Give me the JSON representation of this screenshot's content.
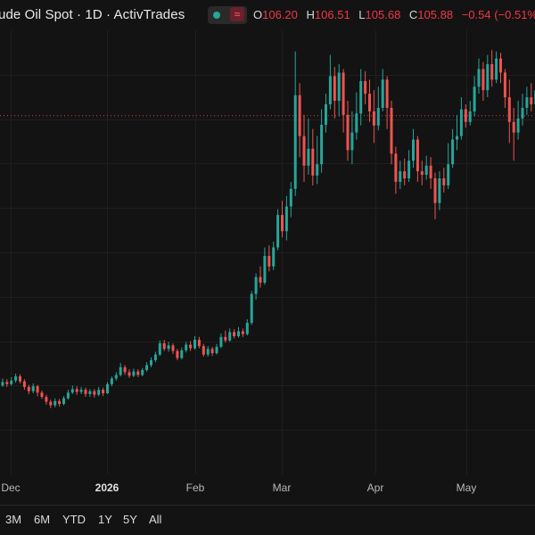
{
  "header": {
    "title": "ude Oil Spot · 1D · ActivTrades",
    "ohlc": [
      {
        "key": "O",
        "value": "106.20"
      },
      {
        "key": "H",
        "value": "106.51"
      },
      {
        "key": "L",
        "value": "105.68"
      },
      {
        "key": "C",
        "value": "105.88"
      }
    ],
    "change": "−0.54 (−0.51%",
    "status_icon": "waves-icon"
  },
  "range_buttons": [
    "3M",
    "6M",
    "YTD",
    "1Y",
    "5Y",
    "All"
  ],
  "colors": {
    "up": "#26a69a",
    "down": "#ef5350",
    "background": "#131313",
    "grid": "#1f1f1f",
    "last_price_line": "#f23645"
  },
  "chart_data": {
    "type": "candlestick",
    "x_tick_labels": [
      "Dec",
      "2026",
      "Feb",
      "Mar",
      "Apr",
      "May"
    ],
    "last_price": 105.88,
    "ylim": [
      55,
      118
    ],
    "candles": [
      [
        68,
        67.6,
        68.4,
        67.2
      ],
      [
        67.6,
        68.1,
        68.6,
        67.4
      ],
      [
        68.1,
        67.8,
        68.5,
        67.4
      ],
      [
        67.8,
        68.3,
        68.8,
        67.6
      ],
      [
        68.3,
        68.9,
        69.3,
        68.0
      ],
      [
        68.9,
        68.2,
        69.2,
        67.9
      ],
      [
        68.2,
        67.4,
        68.5,
        67.0
      ],
      [
        67.4,
        66.8,
        67.7,
        66.4
      ],
      [
        66.8,
        67.5,
        67.9,
        66.5
      ],
      [
        67.5,
        66.6,
        67.7,
        66.1
      ],
      [
        66.6,
        66.0,
        66.9,
        65.7
      ],
      [
        66.0,
        65.3,
        66.3,
        64.9
      ],
      [
        65.3,
        64.8,
        65.6,
        64.4
      ],
      [
        64.8,
        65.4,
        65.8,
        64.5
      ],
      [
        65.4,
        65.0,
        65.7,
        64.6
      ],
      [
        65.0,
        65.8,
        66.1,
        64.8
      ],
      [
        65.8,
        66.6,
        67.0,
        65.6
      ],
      [
        66.6,
        67.1,
        67.6,
        66.4
      ],
      [
        67.1,
        66.7,
        67.5,
        66.3
      ],
      [
        66.7,
        67.0,
        67.4,
        66.4
      ],
      [
        67.0,
        66.4,
        67.3,
        66.0
      ],
      [
        66.4,
        66.8,
        67.1,
        66.0
      ],
      [
        66.8,
        66.3,
        67.1,
        65.9
      ],
      [
        66.3,
        67.0,
        67.4,
        66.1
      ],
      [
        67.0,
        66.5,
        67.3,
        66.1
      ],
      [
        66.5,
        67.8,
        68.1,
        66.4
      ],
      [
        67.8,
        68.6,
        68.9,
        67.5
      ],
      [
        68.6,
        69.1,
        69.5,
        68.3
      ],
      [
        69.1,
        70.2,
        70.8,
        68.9
      ],
      [
        70.2,
        69.5,
        70.5,
        69.1
      ],
      [
        69.5,
        69.0,
        69.9,
        68.7
      ],
      [
        69.0,
        69.6,
        70.0,
        68.8
      ],
      [
        69.6,
        69.1,
        69.9,
        68.8
      ],
      [
        69.1,
        69.8,
        70.1,
        68.9
      ],
      [
        69.8,
        70.5,
        70.9,
        69.6
      ],
      [
        70.5,
        71.2,
        71.6,
        70.2
      ],
      [
        71.2,
        72.0,
        72.4,
        70.9
      ],
      [
        72.0,
        73.6,
        74.0,
        71.8
      ],
      [
        73.6,
        72.8,
        74.1,
        72.5
      ],
      [
        72.8,
        73.3,
        73.8,
        72.4
      ],
      [
        73.3,
        72.5,
        73.6,
        72.1
      ],
      [
        72.5,
        71.5,
        72.8,
        71.2
      ],
      [
        71.5,
        72.6,
        73.0,
        71.3
      ],
      [
        72.6,
        73.4,
        73.8,
        72.3
      ],
      [
        73.4,
        72.9,
        73.9,
        72.5
      ],
      [
        72.9,
        74.1,
        74.6,
        72.7
      ],
      [
        74.1,
        73.2,
        74.5,
        72.9
      ],
      [
        73.2,
        72.0,
        73.5,
        71.7
      ],
      [
        72.0,
        72.8,
        73.2,
        71.7
      ],
      [
        72.8,
        72.2,
        73.1,
        71.8
      ],
      [
        72.2,
        73.1,
        73.5,
        72.0
      ],
      [
        73.1,
        74.5,
        75.0,
        72.9
      ],
      [
        74.5,
        74.0,
        75.4,
        73.7
      ],
      [
        74.0,
        75.2,
        75.7,
        73.8
      ],
      [
        75.2,
        74.6,
        75.6,
        74.3
      ],
      [
        74.6,
        75.3,
        75.9,
        74.4
      ],
      [
        75.3,
        74.9,
        75.7,
        74.5
      ],
      [
        74.9,
        76.5,
        77.0,
        74.7
      ],
      [
        76.5,
        80.6,
        81.0,
        76.2
      ],
      [
        80.6,
        83.0,
        83.5,
        79.8
      ],
      [
        83.0,
        82.2,
        84.5,
        81.5
      ],
      [
        82.2,
        86.0,
        87.2,
        81.9
      ],
      [
        86.0,
        84.5,
        87.5,
        83.8
      ],
      [
        84.5,
        87.2,
        88.0,
        84.0
      ],
      [
        87.2,
        91.8,
        92.6,
        86.8
      ],
      [
        91.8,
        89.5,
        93.8,
        88.6
      ],
      [
        89.5,
        93.0,
        94.5,
        88.2
      ],
      [
        93.0,
        95.5,
        96.5,
        91.5
      ],
      [
        95.5,
        108.8,
        115.0,
        94.5
      ],
      [
        108.8,
        103.0,
        110.5,
        100.0
      ],
      [
        103.0,
        98.8,
        106.0,
        96.5
      ],
      [
        98.8,
        101.2,
        105.5,
        97.5
      ],
      [
        101.2,
        97.4,
        104.0,
        96.0
      ],
      [
        97.4,
        99.0,
        103.0,
        96.2
      ],
      [
        99.0,
        104.6,
        106.8,
        97.8
      ],
      [
        104.6,
        107.5,
        109.0,
        103.5
      ],
      [
        107.5,
        111.5,
        114.5,
        106.8
      ],
      [
        111.5,
        108.0,
        112.8,
        105.5
      ],
      [
        108.0,
        112.0,
        113.2,
        105.8
      ],
      [
        112.0,
        106.0,
        112.5,
        103.5
      ],
      [
        106.0,
        101.0,
        108.0,
        99.5
      ],
      [
        101.0,
        103.5,
        106.5,
        99.0
      ],
      [
        103.5,
        106.2,
        109.2,
        102.5
      ],
      [
        106.2,
        110.8,
        112.5,
        104.5
      ],
      [
        110.8,
        109.0,
        112.2,
        107.5
      ],
      [
        109.0,
        106.5,
        111.0,
        105.0
      ],
      [
        106.5,
        104.5,
        109.5,
        102.0
      ],
      [
        104.5,
        107.0,
        110.0,
        103.8
      ],
      [
        107.0,
        111.0,
        112.5,
        106.5
      ],
      [
        111.0,
        107.0,
        111.5,
        104.0
      ],
      [
        107.0,
        100.5,
        108.0,
        99.0
      ],
      [
        100.5,
        96.5,
        101.5,
        94.8
      ],
      [
        96.5,
        98.0,
        99.5,
        95.5
      ],
      [
        98.0,
        97.0,
        99.8,
        96.0
      ],
      [
        97.0,
        99.5,
        101.0,
        96.5
      ],
      [
        99.5,
        102.5,
        104.0,
        98.5
      ],
      [
        102.5,
        98.0,
        103.0,
        96.5
      ],
      [
        98.0,
        97.5,
        99.5,
        96.0
      ],
      [
        97.5,
        98.8,
        100.2,
        96.8
      ],
      [
        98.8,
        97.0,
        100.0,
        95.5
      ],
      [
        97.0,
        93.5,
        97.8,
        91.2
      ],
      [
        93.5,
        97.0,
        98.0,
        92.5
      ],
      [
        97.0,
        96.0,
        98.5,
        95.0
      ],
      [
        96.0,
        99.0,
        102.0,
        95.5
      ],
      [
        99.0,
        102.5,
        104.0,
        98.5
      ],
      [
        102.5,
        103.0,
        106.0,
        101.0
      ],
      [
        103.0,
        106.8,
        108.5,
        102.5
      ],
      [
        106.8,
        105.0,
        107.5,
        104.2
      ],
      [
        105.0,
        106.5,
        108.0,
        104.5
      ],
      [
        106.5,
        110.0,
        111.5,
        105.8
      ],
      [
        110.0,
        112.5,
        114.0,
        109.0
      ],
      [
        112.5,
        109.5,
        113.5,
        108.0
      ],
      [
        109.5,
        113.2,
        114.5,
        108.5
      ],
      [
        113.2,
        111.0,
        115.2,
        110.0
      ],
      [
        111.0,
        114.0,
        115.0,
        110.5
      ],
      [
        114.0,
        112.0,
        114.8,
        110.5
      ],
      [
        112.0,
        108.5,
        112.5,
        107.0
      ],
      [
        108.5,
        105.0,
        111.0,
        102.0
      ],
      [
        105.0,
        103.5,
        107.0,
        99.5
      ],
      [
        103.5,
        105.5,
        108.0,
        102.5
      ],
      [
        105.5,
        107.0,
        109.0,
        104.5
      ],
      [
        107.0,
        108.5,
        110.0,
        106.0
      ],
      [
        108.5,
        107.5,
        110.5,
        106.5
      ],
      [
        107.5,
        109.5,
        110.5,
        106.5
      ],
      [
        109.5,
        111.0,
        111.8,
        108.2
      ],
      [
        111.0,
        108.5,
        111.5,
        106.5
      ],
      [
        108.5,
        106.5,
        109.0,
        104.5
      ],
      [
        106.5,
        106.2,
        107.5,
        105.0
      ],
      [
        106.2,
        105.88,
        106.51,
        105.68
      ]
    ]
  }
}
